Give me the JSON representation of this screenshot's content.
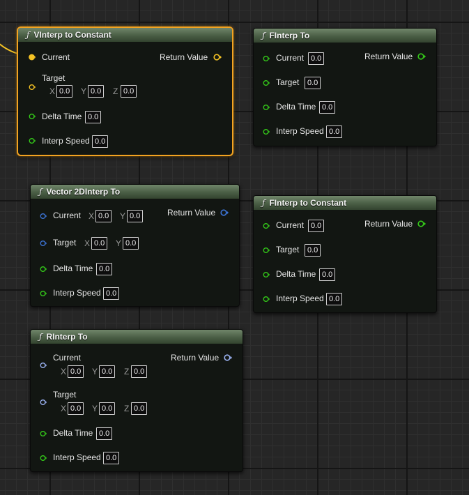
{
  "colors": {
    "float_pin": "#34c919",
    "vector_pin": "#f4c224",
    "vector2d_pin": "#3c74d6",
    "rotator_pin": "#9bb2f2",
    "selection": "#f3a321"
  },
  "icons": {
    "function": "ƒ"
  },
  "nodes": {
    "vinterp_const": {
      "title": "VInterp to Constant",
      "current": "Current",
      "target": "Target",
      "x_axis": "X",
      "y_axis": "Y",
      "z_axis": "Z",
      "target_x": "0.0",
      "target_y": "0.0",
      "target_z": "0.0",
      "delta_time": "Delta Time",
      "delta_time_value": "0.0",
      "interp_speed": "Interp Speed",
      "interp_speed_value": "0.0",
      "return_value": "Return Value"
    },
    "finterp_to": {
      "title": "FInterp To",
      "current": "Current",
      "current_value": "0.0",
      "target": "Target",
      "target_value": "0.0",
      "delta_time": "Delta Time",
      "delta_time_value": "0.0",
      "interp_speed": "Interp Speed",
      "interp_speed_value": "0.0",
      "return_value": "Return Value"
    },
    "vector2d_interp": {
      "title": "Vector 2DInterp To",
      "current": "Current",
      "x_axis": "X",
      "y_axis": "Y",
      "current_x": "0.0",
      "current_y": "0.0",
      "target": "Target",
      "target_x": "0.0",
      "target_y": "0.0",
      "delta_time": "Delta Time",
      "delta_time_value": "0.0",
      "interp_speed": "Interp Speed",
      "interp_speed_value": "0.0",
      "return_value": "Return Value"
    },
    "finterp_const": {
      "title": "FInterp to Constant",
      "current": "Current",
      "current_value": "0.0",
      "target": "Target",
      "target_value": "0.0",
      "delta_time": "Delta Time",
      "delta_time_value": "0.0",
      "interp_speed": "Interp Speed",
      "interp_speed_value": "0.0",
      "return_value": "Return Value"
    },
    "rinterp_to": {
      "title": "RInterp To",
      "current": "Current",
      "x_axis": "X",
      "y_axis": "Y",
      "z_axis": "Z",
      "current_x": "0.0",
      "current_y": "0.0",
      "current_z": "0.0",
      "target": "Target",
      "target_x": "0.0",
      "target_y": "0.0",
      "target_z": "0.0",
      "delta_time": "Delta Time",
      "delta_time_value": "0.0",
      "interp_speed": "Interp Speed",
      "interp_speed_value": "0.0",
      "return_value": "Return Value"
    }
  }
}
